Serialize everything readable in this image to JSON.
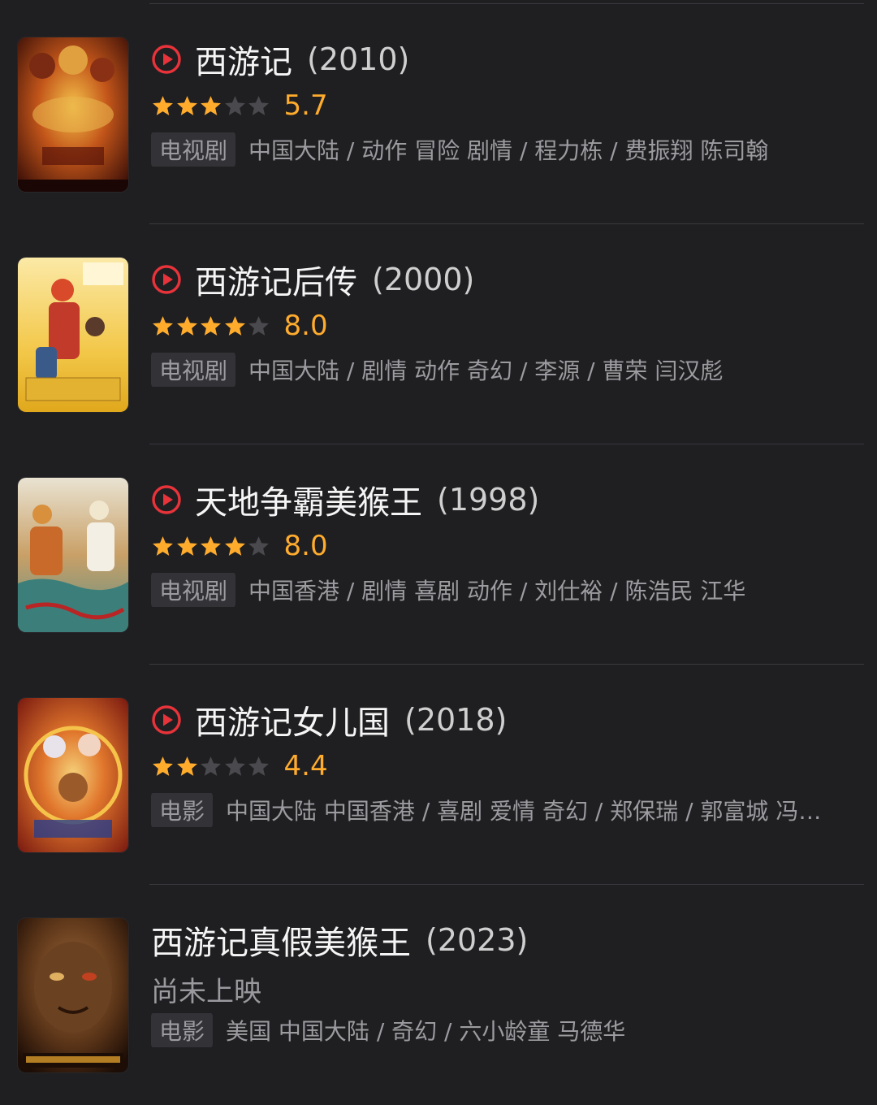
{
  "colors": {
    "background": "#1f1f22",
    "accent_play": "#e8333a",
    "star_on": "#ffac2d",
    "star_off": "#4a4a4e",
    "text_secondary": "#9c9ca0"
  },
  "results": [
    {
      "title": "西游记",
      "year": "(2010)",
      "playable": true,
      "stars": 3,
      "score": "5.7",
      "status": "",
      "tag": "电视剧",
      "meta": "中国大陆 / 动作 冒险 剧情 / 程力栋 / 费振翔 陈司翰"
    },
    {
      "title": "西游记后传",
      "year": "(2000)",
      "playable": true,
      "stars": 4,
      "score": "8.0",
      "status": "",
      "tag": "电视剧",
      "meta": "中国大陆 / 剧情 动作 奇幻 / 李源 / 曹荣 闫汉彪"
    },
    {
      "title": "天地争霸美猴王",
      "year": "(1998)",
      "playable": true,
      "stars": 4,
      "score": "8.0",
      "status": "",
      "tag": "电视剧",
      "meta": "中国香港 / 剧情 喜剧 动作 / 刘仕裕 / 陈浩民 江华"
    },
    {
      "title": "西游记女儿国",
      "year": "(2018)",
      "playable": true,
      "stars": 2,
      "score": "4.4",
      "status": "",
      "tag": "电影",
      "meta": "中国大陆 中国香港 / 喜剧 爱情 奇幻 / 郑保瑞 / 郭富城 冯…"
    },
    {
      "title": "西游记真假美猴王",
      "year": "(2023)",
      "playable": false,
      "stars": 0,
      "score": "",
      "status": "尚未上映",
      "tag": "电影",
      "meta": "美国 中国大陆 / 奇幻 / 六小龄童 马德华"
    }
  ]
}
